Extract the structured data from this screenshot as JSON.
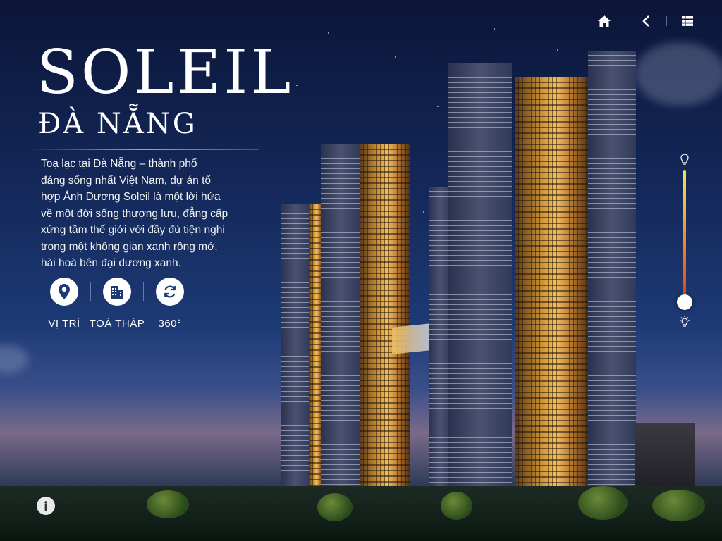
{
  "nav": {
    "home_icon": "home-icon",
    "back_icon": "back-icon",
    "menu_icon": "menu-icon"
  },
  "title": "SOLEIL",
  "subtitle": "ĐÀ NẴNG",
  "description_lines": [
    "Toạ lạc tại Đà Nẵng – thành phố",
    "đáng sống nhất Việt Nam, dự án tổ",
    "hợp Ánh Dương Soleil là một lời hứa",
    "về một đời sống thượng lưu, đẳng cấp",
    "xứng tầm thế giới với đầy đủ tiện nghi",
    "trong một không gian xanh rộng mở,",
    "hài hoà bên đại dương xanh."
  ],
  "features": [
    {
      "label": "VỊ TRÍ",
      "icon": "map-pin-icon"
    },
    {
      "label": "TOÀ THÁP",
      "icon": "building-icon"
    },
    {
      "label": "360°",
      "icon": "rotate-icon"
    }
  ],
  "brightness": {
    "level": 0.0,
    "top_icon": "bulb-off-icon",
    "bottom_icon": "bulb-on-icon"
  },
  "info_icon": "info-icon",
  "colors": {
    "accent_gold": "#f2c060",
    "slider_top": "#f3e35a",
    "slider_bottom": "#d83a10",
    "sky_dark": "#0b1638"
  }
}
